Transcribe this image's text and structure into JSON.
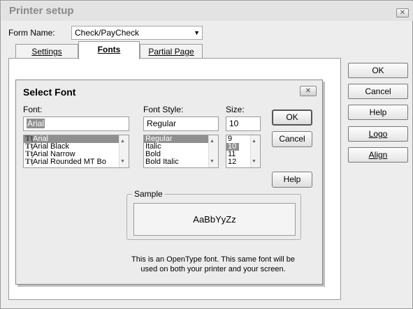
{
  "window": {
    "title": "Printer setup",
    "close_glyph": "✕"
  },
  "form_name": {
    "label": "Form Name:",
    "value": "Check/PayCheck",
    "arrow": "▼"
  },
  "tabs": [
    {
      "label": "Settings"
    },
    {
      "label": "Fonts"
    },
    {
      "label": "Partial Page"
    }
  ],
  "side_buttons": {
    "ok": "OK",
    "cancel": "Cancel",
    "help": "Help",
    "logo": "Logo",
    "align": "Align"
  },
  "font_dialog": {
    "title": "Select Font",
    "close_glyph": "✕",
    "font_label": "Font:",
    "font_value": "Arial",
    "font_list": [
      "Arial",
      "Arial Black",
      "Arial Narrow",
      "Arial Rounded MT Bo"
    ],
    "font_icon": "Tţ",
    "style_label": "Font Style:",
    "style_value": "Regular",
    "style_list": [
      "Regular",
      "Italic",
      "Bold",
      "Bold Italic"
    ],
    "size_label": "Size:",
    "size_value": "10",
    "size_list": [
      "9",
      "10",
      "11",
      "12"
    ],
    "ok_label": "OK",
    "cancel_label": "Cancel",
    "help_label": "Help",
    "sample_label": "Sample",
    "sample_text": "AaBbYyZz",
    "note_line1": "This is an OpenType font. This same font will be",
    "note_line2": "used on both your printer and your screen."
  },
  "colors": {
    "selection": "#8f8f8f",
    "panel": "#ffffff",
    "window_bg": "#ededed"
  }
}
